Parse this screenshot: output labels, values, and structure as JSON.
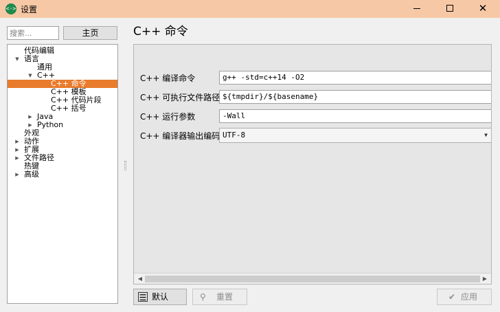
{
  "window": {
    "title": "设置",
    "app_icon": "<·>"
  },
  "window_controls": {
    "minimize_icon": "minimize-icon",
    "maximize_icon": "maximize-icon",
    "close_glyph": "✕"
  },
  "left": {
    "search_placeholder": "搜索...",
    "home_label": "主页",
    "tree": [
      {
        "label": "代码编辑",
        "level": 1,
        "expander": "none"
      },
      {
        "label": "语言",
        "level": 1,
        "expander": "expanded"
      },
      {
        "label": "通用",
        "level": 2,
        "expander": "none"
      },
      {
        "label": "C++",
        "level": 2,
        "expander": "expanded"
      },
      {
        "label": "C++ 命令",
        "level": 3,
        "expander": "none",
        "selected": true
      },
      {
        "label": "C++ 模板",
        "level": 3,
        "expander": "none"
      },
      {
        "label": "C++ 代码片段",
        "level": 3,
        "expander": "none"
      },
      {
        "label": "C++ 括号",
        "level": 3,
        "expander": "none"
      },
      {
        "label": "Java",
        "level": 2,
        "expander": "collapsed"
      },
      {
        "label": "Python",
        "level": 2,
        "expander": "collapsed"
      },
      {
        "label": "外观",
        "level": 1,
        "expander": "none"
      },
      {
        "label": "动作",
        "level": 1,
        "expander": "collapsed"
      },
      {
        "label": "扩展",
        "level": 1,
        "expander": "collapsed"
      },
      {
        "label": "文件路径",
        "level": 1,
        "expander": "collapsed"
      },
      {
        "label": "热键",
        "level": 1,
        "expander": "none"
      },
      {
        "label": "高级",
        "level": 1,
        "expander": "collapsed"
      }
    ]
  },
  "main": {
    "heading": "C++ 命令",
    "fields": [
      {
        "label": "C++ 编译命令",
        "value": "g++ -std=c++14 -O2",
        "kind": "text"
      },
      {
        "label": "C++ 可执行文件路径",
        "value": "${tmpdir}/${basename}",
        "kind": "text"
      },
      {
        "label": "C++ 运行参数",
        "value": "-Wall",
        "kind": "text"
      },
      {
        "label": "C++ 编译器输出编码",
        "value": "UTF-8",
        "kind": "select"
      }
    ]
  },
  "buttons": {
    "default_label": "默认",
    "reset_label": "重置",
    "apply_label": "应用"
  },
  "colors": {
    "titlebar": "#f7c8a6",
    "selection": "#e97b2c",
    "app_icon": "#1f8a4c"
  }
}
